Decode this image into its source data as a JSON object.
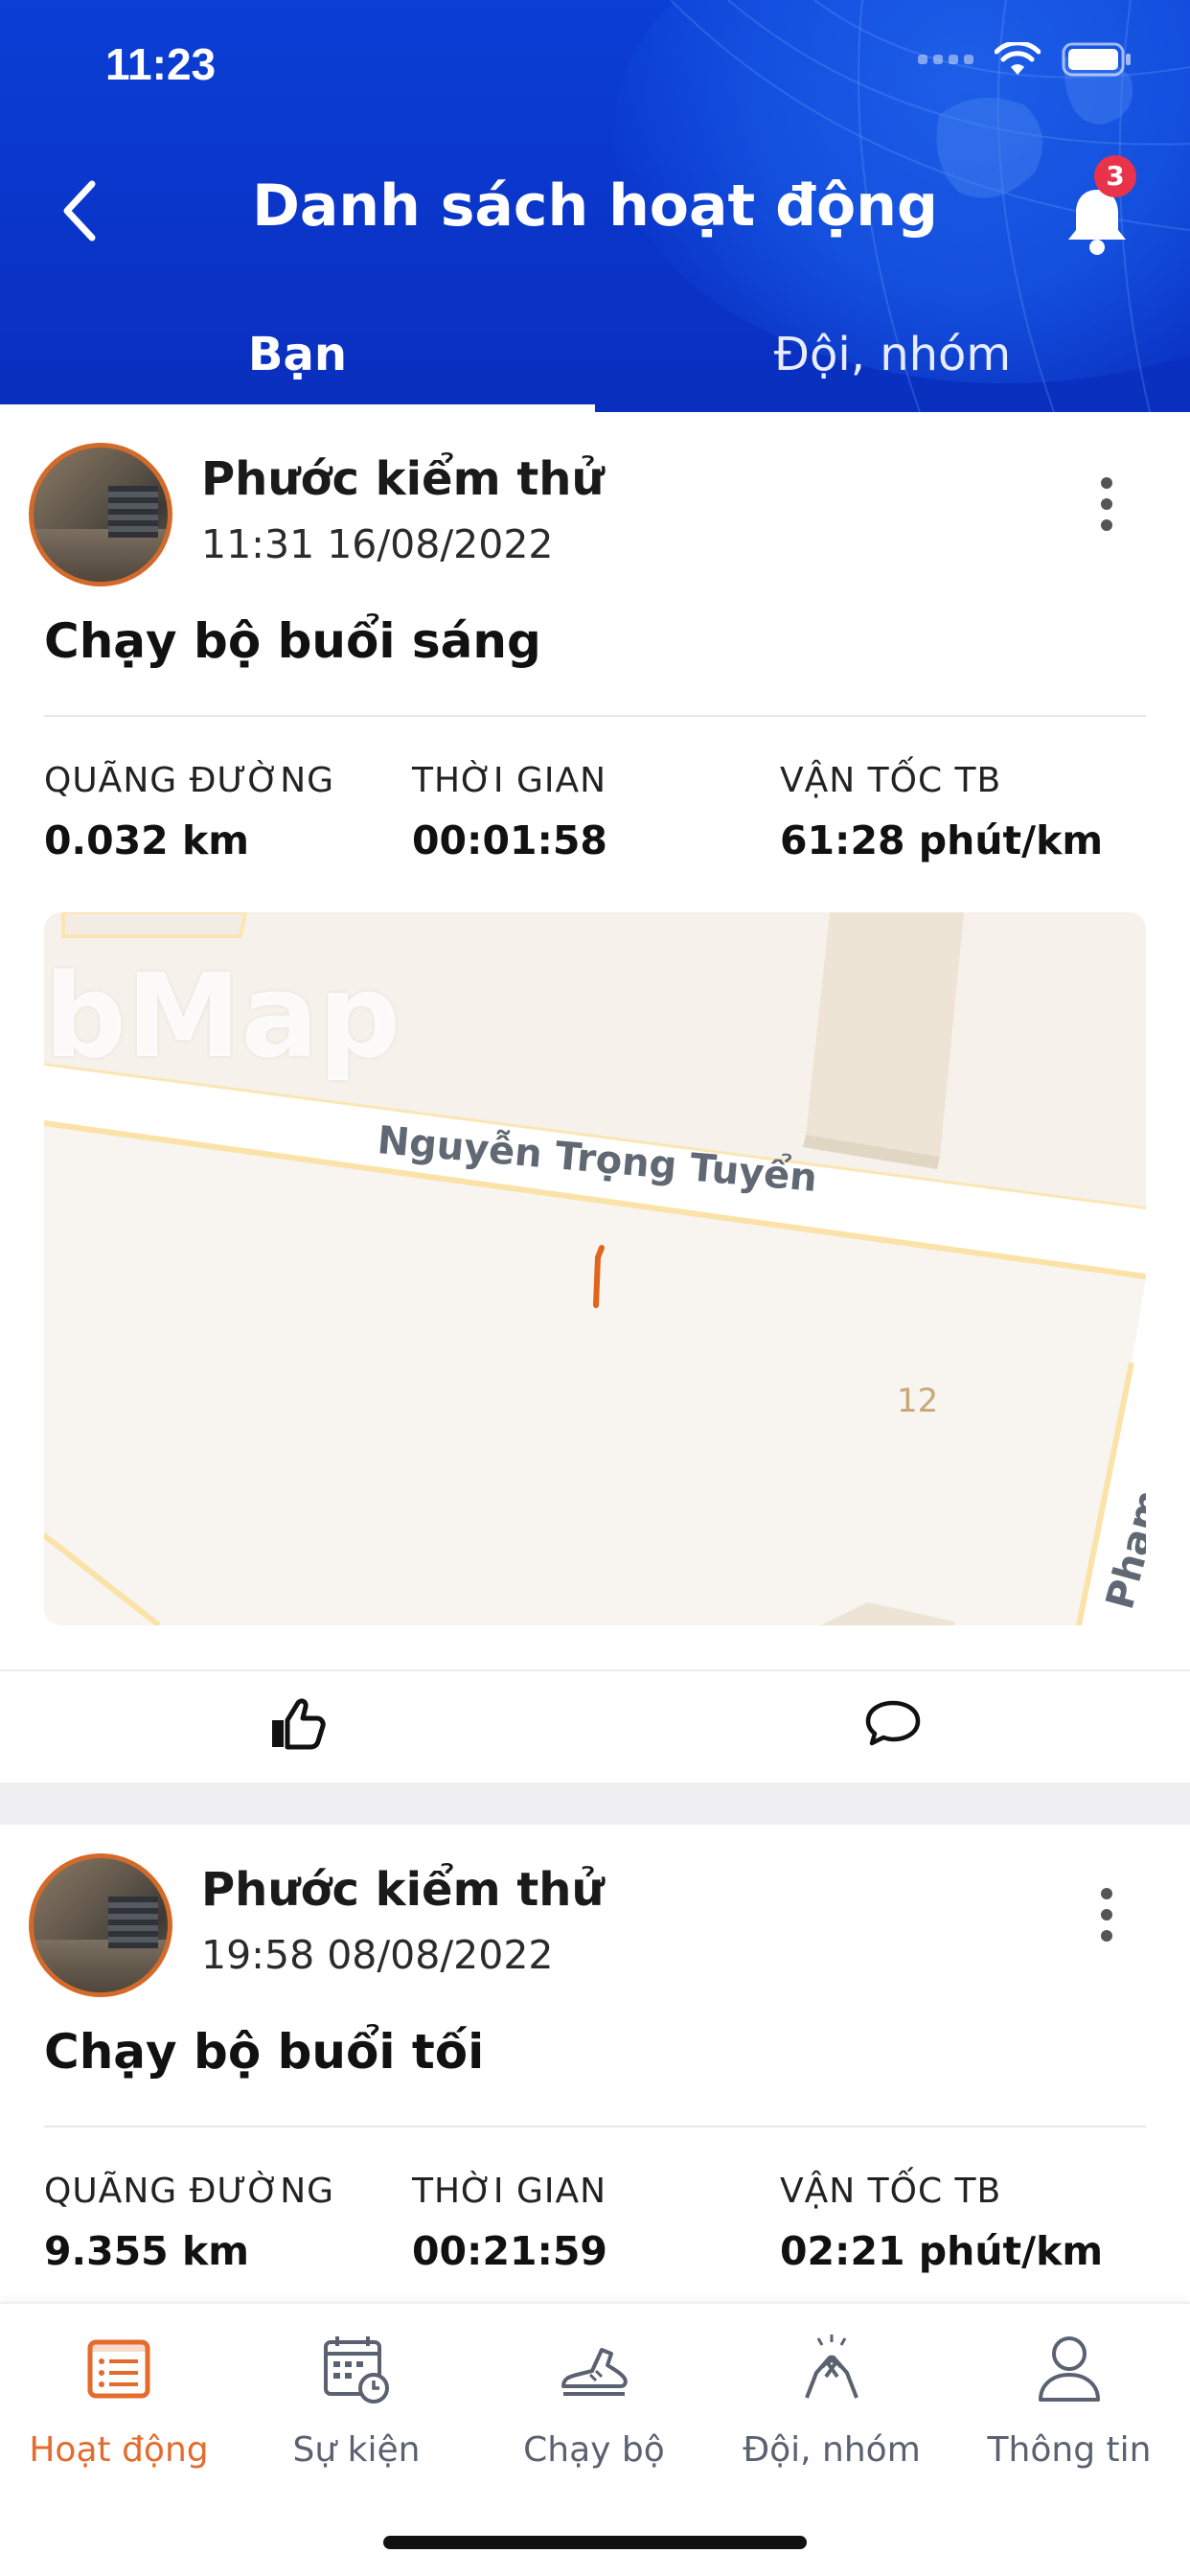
{
  "status_bar": {
    "time": "11:23"
  },
  "header": {
    "title": "Danh sách hoạt động",
    "notification_count": "3",
    "tabs": [
      {
        "label": "Bạn",
        "active": true
      },
      {
        "label": "Đội, nhóm",
        "active": false
      }
    ]
  },
  "activities": [
    {
      "user_name": "Phước kiểm thử",
      "time": "11:31 16/08/2022",
      "title": "Chạy bộ buổi sáng",
      "stats": [
        {
          "label": "QUÃNG ĐƯỜNG",
          "value": "0.032 km"
        },
        {
          "label": "THỜI GIAN",
          "value": "00:01:58"
        },
        {
          "label": "VẬN TỐC TB",
          "value": "61:28 phút/km"
        }
      ],
      "map": {
        "logo_text": "bMap",
        "street": "Nguyễn Trọng Tuyển",
        "house_number": "12",
        "street_partial": "Phạm Vă"
      }
    },
    {
      "user_name": "Phước kiểm thử",
      "time": "19:58 08/08/2022",
      "title": "Chạy bộ buổi tối",
      "stats": [
        {
          "label": "QUÃNG ĐƯỜNG",
          "value": "9.355 km"
        },
        {
          "label": "THỜI GIAN",
          "value": "00:21:59"
        },
        {
          "label": "VẬN TỐC TB",
          "value": "02:21 phút/km"
        }
      ]
    }
  ],
  "bottom_nav": [
    {
      "label": "Hoạt động",
      "icon": "activity-list-icon",
      "active": true
    },
    {
      "label": "Sự kiện",
      "icon": "calendar-clock-icon",
      "active": false
    },
    {
      "label": "Chạy bộ",
      "icon": "running-shoe-icon",
      "active": false
    },
    {
      "label": "Đội, nhóm",
      "icon": "team-handshake-icon",
      "active": false
    },
    {
      "label": "Thông tin",
      "icon": "user-profile-icon",
      "active": false
    }
  ],
  "colors": {
    "header_blue": "#0b3fd6",
    "accent_orange": "#e46b2c",
    "badge_red": "#e8334a"
  }
}
